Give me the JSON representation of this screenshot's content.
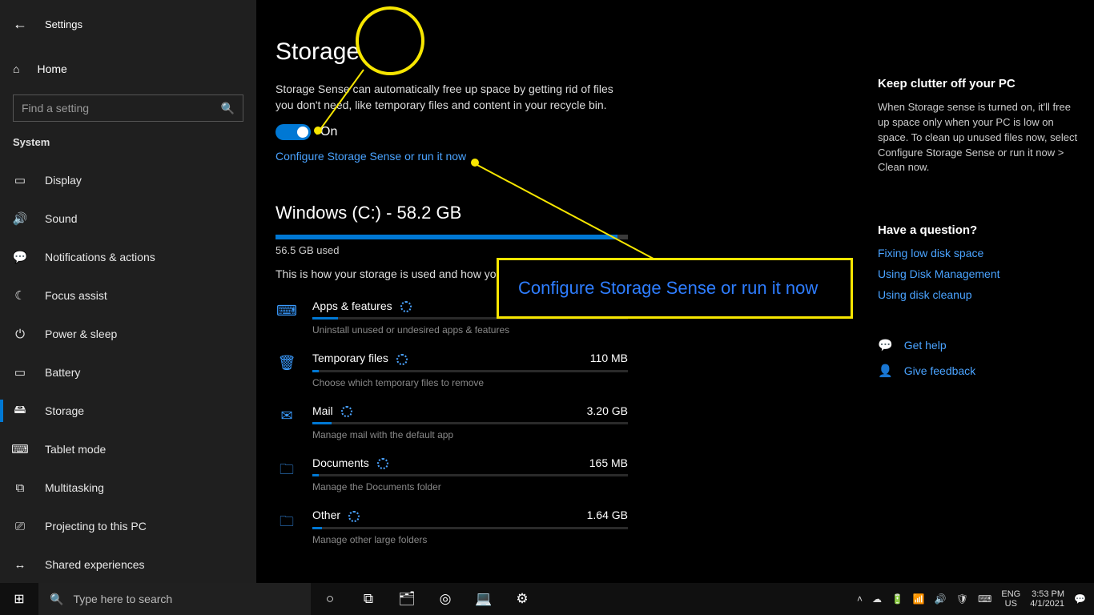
{
  "window": {
    "title": "Settings",
    "minimize": "–",
    "maximize": "▢",
    "close": "✕"
  },
  "sidebar": {
    "home": "Home",
    "search_placeholder": "Find a setting",
    "section": "System",
    "items": [
      {
        "icon": "▭",
        "label": "Display"
      },
      {
        "icon": "🔊",
        "label": "Sound"
      },
      {
        "icon": "💬",
        "label": "Notifications & actions"
      },
      {
        "icon": "☾",
        "label": "Focus assist"
      },
      {
        "icon": "⏻",
        "label": "Power & sleep"
      },
      {
        "icon": "▭",
        "label": "Battery"
      },
      {
        "icon": "🖴",
        "label": "Storage"
      },
      {
        "icon": "⌨",
        "label": "Tablet mode"
      },
      {
        "icon": "⧉",
        "label": "Multitasking"
      },
      {
        "icon": "⎚",
        "label": "Projecting to this PC"
      },
      {
        "icon": "↔",
        "label": "Shared experiences"
      }
    ],
    "active_index": 6
  },
  "page": {
    "title": "Storage",
    "desc": "Storage Sense can automatically free up space by getting rid of files you don't need, like temporary files and content in your recycle bin.",
    "toggle_state": "On",
    "configure_link": "Configure Storage Sense or run it now",
    "drive": {
      "label": "Windows (C:) - 58.2 GB",
      "used_label": "56.5 GB used",
      "fill_pct": 97
    },
    "how_text": "This is how your storage is used and how you",
    "categories": [
      {
        "icon": "⌨",
        "name": "Apps & features",
        "size": "",
        "sub": "Uninstall unused or undesired apps & features",
        "fill": 8,
        "loading": true
      },
      {
        "icon": "🗑",
        "name": "Temporary files",
        "size": "110 MB",
        "sub": "Choose which temporary files to remove",
        "fill": 2,
        "loading": true
      },
      {
        "icon": "✉",
        "name": "Mail",
        "size": "3.20 GB",
        "sub": "Manage mail with the default app",
        "fill": 6,
        "loading": true
      },
      {
        "icon": "🗀",
        "name": "Documents",
        "size": "165 MB",
        "sub": "Manage the Documents folder",
        "fill": 2,
        "loading": true
      },
      {
        "icon": "🗀",
        "name": "Other",
        "size": "1.64 GB",
        "sub": "Manage other large folders",
        "fill": 3,
        "loading": true
      }
    ]
  },
  "right": {
    "clutter_head": "Keep clutter off your PC",
    "clutter_body": "When Storage sense is turned on, it'll free up space only when your PC is low on space. To clean up unused files now, select Configure Storage Sense or run it now > Clean now.",
    "question_head": "Have a question?",
    "q_links": [
      "Fixing low disk space",
      "Using Disk Management",
      "Using disk cleanup"
    ],
    "get_help": "Get help",
    "give_feedback": "Give feedback"
  },
  "callout_text": "Configure Storage Sense or run it now",
  "taskbar": {
    "search_placeholder": "Type here to search",
    "apps": [
      {
        "name": "cortana",
        "glyph": "○"
      },
      {
        "name": "task-view",
        "glyph": "⧉"
      },
      {
        "name": "file-explorer",
        "glyph": "🗂"
      },
      {
        "name": "chrome",
        "glyph": "◎"
      },
      {
        "name": "remote",
        "glyph": "💻"
      },
      {
        "name": "settings",
        "glyph": "⚙"
      }
    ],
    "lang1": "ENG",
    "lang2": "US",
    "time": "3:53 PM",
    "date": "4/1/2021"
  }
}
